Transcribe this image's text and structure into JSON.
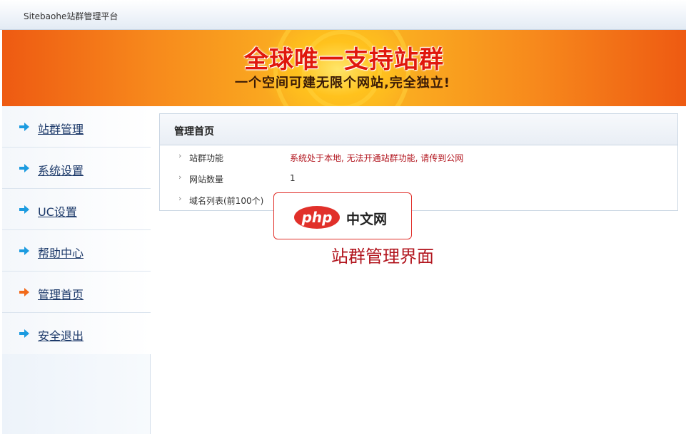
{
  "header": {
    "app_title": "Sitebaohe站群管理平台"
  },
  "banner": {
    "headline": "全球唯一支持站群",
    "subline": "一个空间可建无限个网站,完全独立!"
  },
  "sidebar": {
    "items": [
      {
        "label": "站群管理",
        "arrow_color": "#1c9be0"
      },
      {
        "label": "系统设置",
        "arrow_color": "#1c9be0"
      },
      {
        "label": "UC设置",
        "arrow_color": "#1c9be0"
      },
      {
        "label": "帮助中心",
        "arrow_color": "#1c9be0"
      },
      {
        "label": "管理首页",
        "arrow_color": "#f26a1b"
      },
      {
        "label": "安全退出",
        "arrow_color": "#1c9be0"
      }
    ]
  },
  "panel": {
    "title": "管理首页",
    "rows": [
      {
        "key": "站群功能",
        "value": "系统处于本地, 无法开通站群功能, 请传到公网"
      },
      {
        "key": "网站数量",
        "value": "1"
      },
      {
        "key": "域名列表(前100个)",
        "value": ""
      }
    ]
  },
  "watermark": {
    "logo_text": "php",
    "site_text": "中文网",
    "caption": "站群管理界面"
  },
  "colors": {
    "warning_text": "#b2151e",
    "banner_orange": "#f7891c",
    "watermark_red": "#e1302a"
  }
}
